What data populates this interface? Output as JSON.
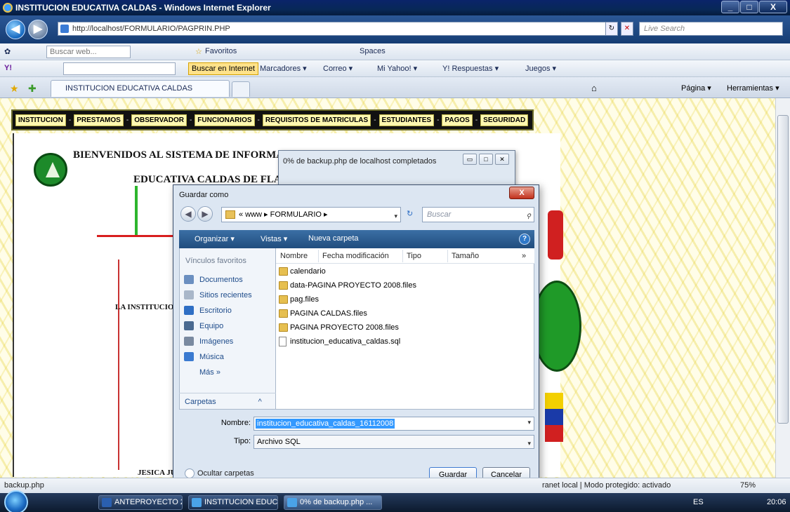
{
  "window": {
    "title": "INSTITUCION EDUCATIVA CALDAS - Windows Internet Explorer",
    "minimize": "_",
    "maximize": "□",
    "close": "X"
  },
  "address": {
    "url": "http://localhost/FORMULARIO/PAGPRIN.PHP",
    "search_placeholder": "Live Search"
  },
  "toolbar1": {
    "search_placeholder": "Buscar web...",
    "favoritos": "Favoritos",
    "spaces": "Spaces"
  },
  "toolbar2": {
    "buscar_internet": "Buscar en Internet",
    "marcadores": "Marcadores ▾",
    "correo": "Correo ▾",
    "yahoo": "Mi Yahoo! ▾",
    "respuestas": "Y! Respuestas ▾",
    "juegos": "Juegos ▾"
  },
  "tabs": {
    "active": "INSTITUCION EDUCATIVA CALDAS",
    "pagina": "Página ▾",
    "herramientas": "Herramientas ▾"
  },
  "site": {
    "menu": [
      "INSTITUCION",
      "PRESTAMOS",
      "OBSERVADOR",
      "FUNCIONARIOS",
      "REQUISITOS DE MATRICULAS",
      "ESTUDIANTES",
      "PAGOS",
      "SEGURIDAD"
    ],
    "headline1": "BIENVENIDOS AL SISTEMA DE INFORMA",
    "headline2": "EDUCATIVA CALDAS DE FLA",
    "partial1": "LA INSTITUCIO",
    "partial2": "JESICA JULI"
  },
  "download_dialog": {
    "title": "0% de backup.php de localhost completados"
  },
  "save_dialog": {
    "title": "Guardar como",
    "path": "« www ▸ FORMULARIO ▸",
    "search_placeholder": "Buscar",
    "organizar": "Organizar ▾",
    "vistas": "Vistas ▾",
    "nueva_carpeta": "Nueva carpeta",
    "favorites_header": "Vínculos favoritos",
    "favorites": [
      "Documentos",
      "Sitios recientes",
      "Escritorio",
      "Equipo",
      "Imágenes",
      "Música"
    ],
    "mas": "Más »",
    "carpetas": "Carpetas",
    "columns": [
      "Nombre",
      "Fecha modificación",
      "Tipo",
      "Tamaño"
    ],
    "files": [
      "calendario",
      "data-PAGINA PROYECTO 2008.files",
      "pag.files",
      "PAGINA CALDAS.files",
      "PAGINA PROYECTO 2008.files",
      "institucion_educativa_caldas.sql"
    ],
    "nombre_label": "Nombre:",
    "nombre_value": "institucion_educativa_caldas_16112008",
    "tipo_label": "Tipo:",
    "tipo_value": "Archivo SQL",
    "ocultar": "Ocultar carpetas",
    "guardar": "Guardar",
    "cancelar": "Cancelar"
  },
  "status": {
    "left": "backup.php",
    "zone": "ranet local | Modo protegido: activado",
    "zoom": "75%"
  },
  "taskbar": {
    "tasks": [
      "ANTEPROYECTO 20...",
      "INSTITUCION EDUC...",
      "0% de backup.php ..."
    ],
    "lang": "ES",
    "clock": "20:06"
  },
  "colors": {
    "accent": "#1c4f8a",
    "select": "#3399ff",
    "menu_bg": "#111111",
    "page_bg": "#fffde8"
  }
}
